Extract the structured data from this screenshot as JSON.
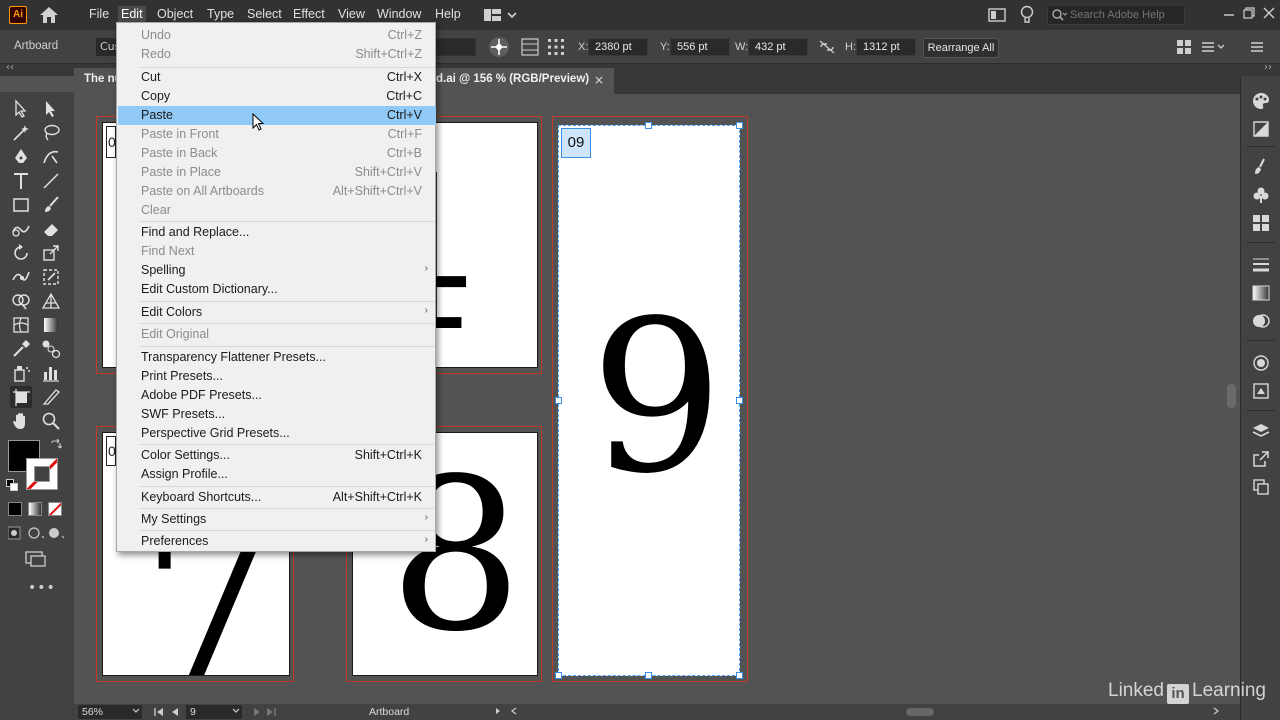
{
  "app": {
    "logo": "Ai",
    "brand_color": "#ff9a00"
  },
  "menubar": {
    "items": [
      "File",
      "Edit",
      "Object",
      "Type",
      "Select",
      "Effect",
      "View",
      "Window",
      "Help"
    ],
    "search_placeholder": "Search Adobe Help"
  },
  "controlbar": {
    "artboard_label": "Artboard",
    "preset_value": "Cus",
    "x_label": "X:",
    "x_value": "2380 pt",
    "y_label": "Y:",
    "y_value": "556 pt",
    "w_label": "W:",
    "w_value": "432 pt",
    "h_label": "H:",
    "h_value": "1312 pt",
    "rearrange_label": "Rearrange All"
  },
  "document": {
    "tab_title_start": "The nu",
    "tab_title_end": "d.ai @ 156 % (RGB/Preview)",
    "close_glyph": "×"
  },
  "artboards": {
    "top_left_label": "0",
    "top_center_glyph": "4",
    "bottom_left_label": "0",
    "bottom_left_glyph": "7",
    "bottom_center_glyph": "8",
    "selected_label": "09",
    "selected_glyph": "9"
  },
  "edit_menu": {
    "items": [
      {
        "label": "Undo",
        "shortcut": "Ctrl+Z",
        "disabled": true
      },
      {
        "label": "Redo",
        "shortcut": "Shift+Ctrl+Z",
        "disabled": true
      },
      {
        "label": "Cut",
        "shortcut": "Ctrl+X",
        "disabled": false
      },
      {
        "label": "Copy",
        "shortcut": "Ctrl+C",
        "disabled": false
      },
      {
        "label": "Paste",
        "shortcut": "Ctrl+V",
        "disabled": false,
        "highlighted": true
      },
      {
        "label": "Paste in Front",
        "shortcut": "Ctrl+F",
        "disabled": true
      },
      {
        "label": "Paste in Back",
        "shortcut": "Ctrl+B",
        "disabled": true
      },
      {
        "label": "Paste in Place",
        "shortcut": "Shift+Ctrl+V",
        "disabled": true
      },
      {
        "label": "Paste on All Artboards",
        "shortcut": "Alt+Shift+Ctrl+V",
        "disabled": true
      },
      {
        "label": "Clear",
        "shortcut": "",
        "disabled": true
      },
      {
        "label": "Find and Replace...",
        "shortcut": "",
        "disabled": false
      },
      {
        "label": "Find Next",
        "shortcut": "",
        "disabled": true
      },
      {
        "label": "Spelling",
        "shortcut": "",
        "disabled": false,
        "submenu": true
      },
      {
        "label": "Edit Custom Dictionary...",
        "shortcut": "",
        "disabled": false
      },
      {
        "label": "Edit Colors",
        "shortcut": "",
        "disabled": false,
        "submenu": true
      },
      {
        "label": "Edit Original",
        "shortcut": "",
        "disabled": true
      },
      {
        "label": "Transparency Flattener Presets...",
        "shortcut": "",
        "disabled": false
      },
      {
        "label": "Print Presets...",
        "shortcut": "",
        "disabled": false
      },
      {
        "label": "Adobe PDF Presets...",
        "shortcut": "",
        "disabled": false
      },
      {
        "label": "SWF Presets...",
        "shortcut": "",
        "disabled": false
      },
      {
        "label": "Perspective Grid Presets...",
        "shortcut": "",
        "disabled": false
      },
      {
        "label": "Color Settings...",
        "shortcut": "Shift+Ctrl+K",
        "disabled": false
      },
      {
        "label": "Assign Profile...",
        "shortcut": "",
        "disabled": false
      },
      {
        "label": "Keyboard Shortcuts...",
        "shortcut": "Alt+Shift+Ctrl+K",
        "disabled": false
      },
      {
        "label": "My Settings",
        "shortcut": "",
        "disabled": false,
        "submenu": true
      },
      {
        "label": "Preferences",
        "shortcut": "",
        "disabled": false,
        "submenu": true
      }
    ]
  },
  "statusbar": {
    "zoom": "56%",
    "page": "9",
    "status_text": "Artboard"
  },
  "watermark": {
    "left": "Linked",
    "mark": "in",
    "right": "Learning"
  },
  "colors": {
    "highlight": "#91c9f7",
    "artboard_outline": "#c0392b",
    "selection": "#3b8fe5"
  }
}
